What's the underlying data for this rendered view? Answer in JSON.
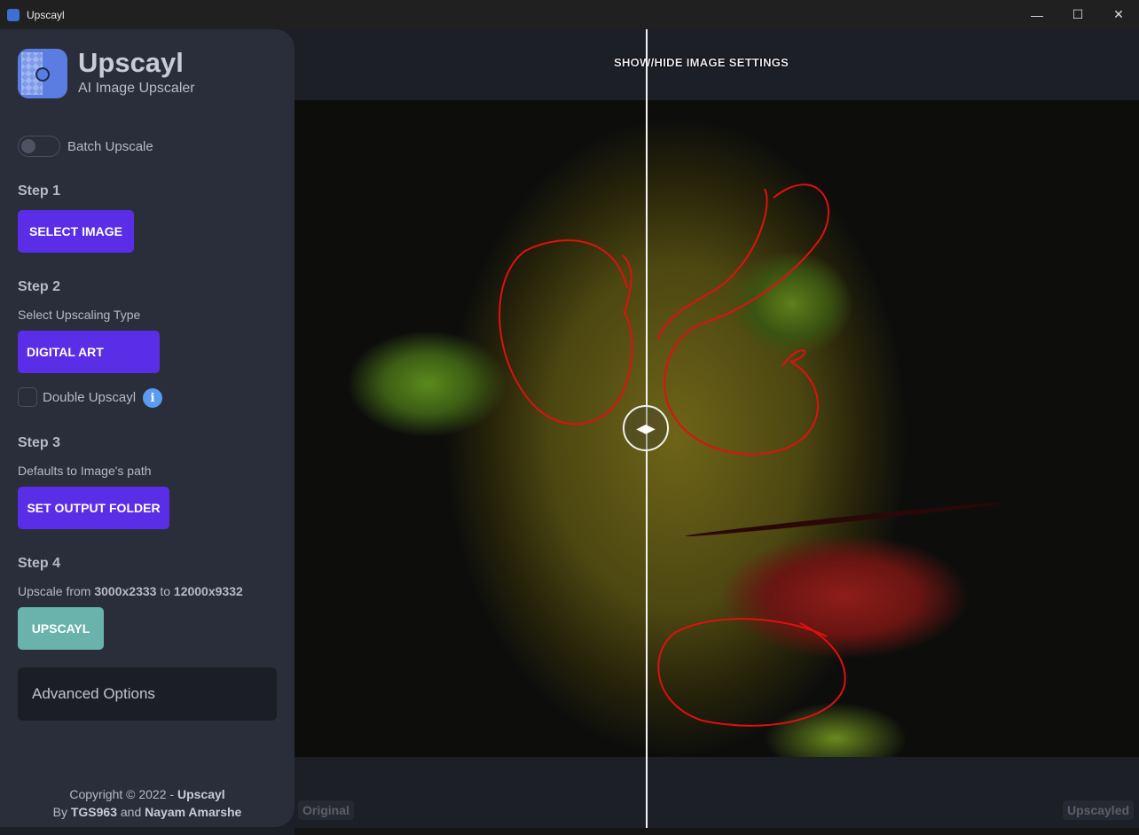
{
  "window": {
    "title": "Upscayl",
    "controls": {
      "minimize": "—",
      "maximize": "☐",
      "close": "✕"
    }
  },
  "sidebar": {
    "app_name": "Upscayl",
    "app_subtitle": "AI Image Upscaler",
    "batch_toggle": {
      "label": "Batch Upscale",
      "enabled": false
    },
    "step1": {
      "title": "Step 1",
      "button": "SELECT IMAGE"
    },
    "step2": {
      "title": "Step 2",
      "subtitle": "Select Upscaling Type",
      "selected_type": "DIGITAL ART",
      "double_upscayl": {
        "label": "Double Upscayl",
        "checked": false,
        "info_icon": "i"
      }
    },
    "step3": {
      "title": "Step 3",
      "subtitle": "Defaults to Image's path",
      "button": "SET OUTPUT FOLDER"
    },
    "step4": {
      "title": "Step 4",
      "upscale_prefix": "Upscale from ",
      "from_size": "3000x2333",
      "to_word": " to ",
      "to_size": "12000x9332",
      "button": "UPSCAYL"
    },
    "advanced_options": "Advanced Options",
    "footer": {
      "line1_prefix": "Copyright © 2022 - ",
      "line1_brand": "Upscayl",
      "line2_by": "By ",
      "author1": "TGS963",
      "and": " and ",
      "author2": "Nayam Amarshe"
    }
  },
  "main": {
    "settings_toggle": "SHOW/HIDE IMAGE SETTINGS",
    "label_original": "Original",
    "label_upscayled": "Upscayled"
  },
  "colors": {
    "accent_purple": "#5a2ee6",
    "upscayl_teal": "#6ab3ad",
    "annotation_red": "#e01010"
  }
}
